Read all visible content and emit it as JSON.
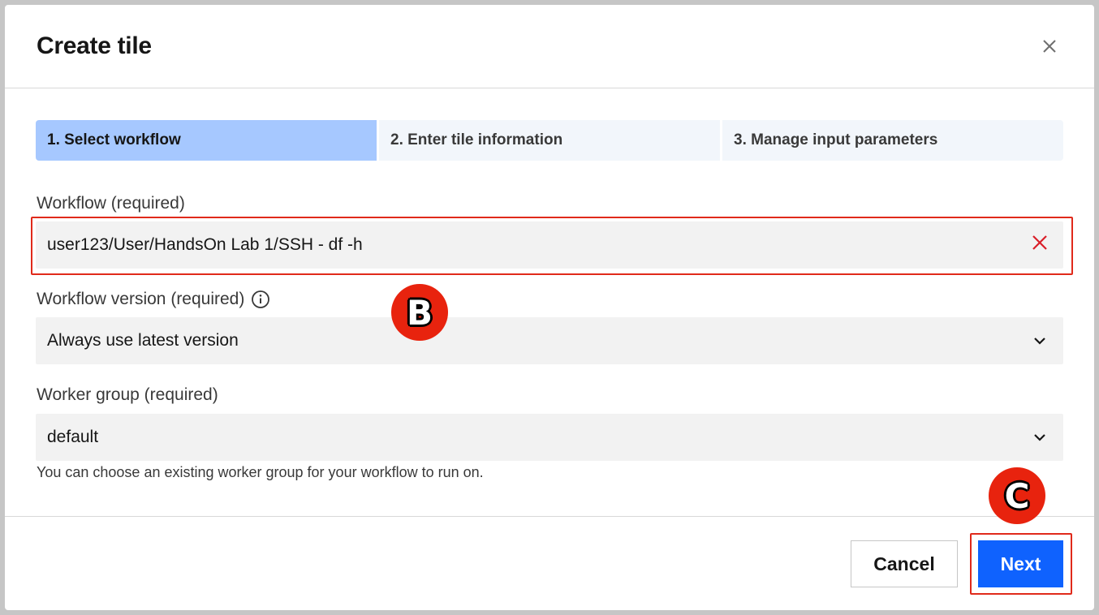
{
  "dialog": {
    "title": "Create tile"
  },
  "stepper": {
    "steps": [
      {
        "label": "1. Select workflow",
        "active": true
      },
      {
        "label": "2. Enter tile information",
        "active": false
      },
      {
        "label": "3. Manage input parameters",
        "active": false
      }
    ]
  },
  "form": {
    "workflow": {
      "label": "Workflow (required)",
      "value": "user123/User/HandsOn Lab 1/SSH - df -h"
    },
    "workflow_version": {
      "label": "Workflow version (required)",
      "value": "Always use latest version"
    },
    "worker_group": {
      "label": "Worker group (required)",
      "value": "default",
      "helper": "You can choose an existing worker group for your workflow to run on."
    }
  },
  "footer": {
    "cancel_label": "Cancel",
    "next_label": "Next"
  },
  "markers": {
    "b": "B",
    "c": "C"
  },
  "colors": {
    "primary": "#0f62fe",
    "step_active": "#a6c8ff",
    "highlight": "#e02a1b",
    "clear_icon": "#da1e28"
  },
  "icons": [
    "close-icon",
    "clear-icon",
    "info-icon",
    "chevron-down-icon"
  ]
}
